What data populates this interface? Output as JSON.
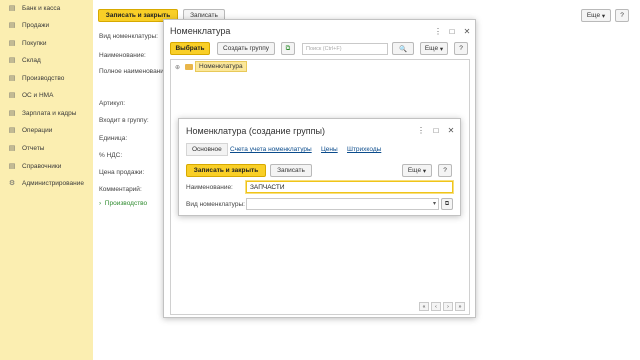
{
  "sidebar": {
    "items": [
      {
        "label": "Банк и касса",
        "icon": "bank-icon",
        "glyph": "▤"
      },
      {
        "label": "Продажи",
        "icon": "sales-icon",
        "glyph": "▤"
      },
      {
        "label": "Покупки",
        "icon": "purchases-icon",
        "glyph": "▤"
      },
      {
        "label": "Склад",
        "icon": "warehouse-icon",
        "glyph": "▤"
      },
      {
        "label": "Производство",
        "icon": "production-icon",
        "glyph": "▤"
      },
      {
        "label": "ОС и НМА",
        "icon": "assets-icon",
        "glyph": "▤"
      },
      {
        "label": "Зарплата и кадры",
        "icon": "salary-icon",
        "glyph": "▤"
      },
      {
        "label": "Операции",
        "icon": "operations-icon",
        "glyph": "▤"
      },
      {
        "label": "Отчеты",
        "icon": "reports-icon",
        "glyph": "▤"
      },
      {
        "label": "Справочники",
        "icon": "catalogs-icon",
        "glyph": "▤"
      },
      {
        "label": "Администрирование",
        "icon": "admin-icon",
        "glyph": "⚙"
      }
    ]
  },
  "background_form": {
    "save_close": "Записать и закрыть",
    "save": "Записать",
    "more": "Еще",
    "more_arrow": "▾",
    "help": "?",
    "labels": {
      "vid": "Вид номенклатуры:",
      "naim": "Наименование:",
      "full_naim": "Полное наименование",
      "article": "Артикул:",
      "group": "Входит в группу:",
      "unit": "Единица:",
      "vat": "% НДС:",
      "price": "Цена продажи:",
      "comment": "Комментарий:",
      "production": "Производство",
      "production_arrow": "›"
    }
  },
  "list_window": {
    "title": "Номенклатура",
    "select": "Выбрать",
    "create_group": "Создать группу",
    "search_placeholder": "Поиск (Ctrl+F)",
    "search_glyph": "🔍",
    "more": "Еще",
    "more_arrow": "▾",
    "help": "?",
    "tree_item": "Номенклатура",
    "tree_toggle": "⊕",
    "menu_glyph": "⋮",
    "max_glyph": "□",
    "close_glyph": "✕",
    "nav": [
      "«",
      "‹",
      "›",
      "»"
    ]
  },
  "group_window": {
    "title": "Номенклатура (создание группы)",
    "tabs": [
      "Основное",
      "Счета учета номенклатуры",
      "Цены",
      "Штрихкоды"
    ],
    "save_close": "Записать и закрыть",
    "save": "Записать",
    "more": "Еще",
    "more_arrow": "▾",
    "help": "?",
    "name_label": "Наименование:",
    "name_value": "ЗАПЧАСТИ",
    "kind_label": "Вид номенклатуры:",
    "kind_value": "",
    "kind_dropdown": "▾",
    "kind_open": "⧉",
    "menu_glyph": "⋮",
    "max_glyph": "□",
    "close_glyph": "✕"
  },
  "colors": {
    "sidebar_bg": "#fbeeb1",
    "accent_yellow": "#f9cf27",
    "link_blue": "#0b4c8c",
    "production_green": "#2e8b2e"
  }
}
